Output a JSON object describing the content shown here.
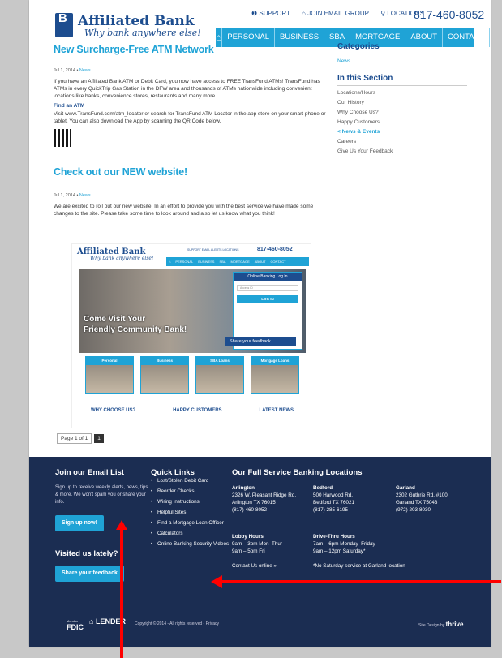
{
  "header": {
    "bank_name": "Affiliated Bank",
    "tagline": "Why bank anywhere else!",
    "logo_letters": "B",
    "utility": [
      "SUPPORT",
      "JOIN EMAIL GROUP",
      "LOCATIONS"
    ],
    "phone": "817-460-8052",
    "nav": [
      "PERSONAL",
      "BUSINESS",
      "SBA",
      "MORTGAGE",
      "ABOUT",
      "CONTACT"
    ]
  },
  "posts": [
    {
      "title": "New Surcharge-Free ATM Network",
      "date": "Jul 1, 2014",
      "category": "News",
      "para1": "If you have an Affiliated Bank ATM or Debit Card, you now have access to FREE TransFund ATMs! TransFund has ATMs in every QuickTrip Gas Station in the DFW area and thousands of ATMs nationwide including convenient locations like banks, convenience stores, restaurants and many more.",
      "subhead": "Find an ATM",
      "para2": "Visit www.TransFund.com/atm_locator or search for TransFund ATM Locator in the app store on your smart phone or tablet.  You can also download the App by scanning the QR Code below."
    },
    {
      "title": "Check out our NEW website!",
      "date": "Jul 1, 2014",
      "category": "News",
      "para1": "We are excited to roll out our new website. In an effort to provide you with the best service we have made some changes to the site. Please take some time to look around and also let us know what you think!"
    }
  ],
  "thumb": {
    "bank_name": "Affiliated Bank",
    "tagline": "Why bank anywhere else!",
    "phone": "817-460-8052",
    "utility": "SUPPORT  EMAIL ALERTS  LOCATIONS",
    "nav": [
      "PERSONAL",
      "BUSINESS",
      "SBA",
      "MORTGAGE",
      "ABOUT",
      "CONTACT"
    ],
    "hero_line1": "Come Visit Your",
    "hero_line2": "Friendly Community Bank!",
    "login_title": "Online Banking Log In",
    "login_placeholder": "Access ID",
    "login_button": "LOG IN",
    "feedback": "Share your feedback",
    "cards": [
      "Personal",
      "Business",
      "SBA Loans",
      "Mortgage Loans"
    ],
    "links": [
      "WHY CHOOSE US?",
      "HAPPY CUSTOMERS",
      "LATEST NEWS"
    ]
  },
  "pager": {
    "label": "Page 1 of 1",
    "current": "1"
  },
  "sidebar": {
    "categories_heading": "Categories",
    "categories": [
      "News"
    ],
    "section_heading": "In this Section",
    "links": [
      "Locations/Hours",
      "Our History",
      "Why Choose Us?",
      "Happy Customers",
      "< News & Events",
      "Careers",
      "Give Us Your Feedback"
    ],
    "active_index": 4
  },
  "footer": {
    "email_heading": "Join our Email List",
    "email_text": "Sign up to receive weekly alerts, news, tips & more. We won't spam you or share your info.",
    "signup_button": "Sign up now!",
    "visited_heading": "Visited us lately?",
    "feedback_button": "Share your feedback",
    "quick_heading": "Quick Links",
    "quick_links": [
      "Lost/Stolen Debit Card",
      "Reorder Checks",
      "Wiring Instructions",
      "Helpful Sites",
      "Find a Mortgage Loan Officer",
      "Calculators",
      "Online Banking Security Videos"
    ],
    "locations_heading": "Our Full Service Banking Locations",
    "locations": [
      {
        "name": "Arlington",
        "l1": "2326 W. Pleasant Ridge Rd.",
        "l2": "Arlington TX 76015",
        "l3": "(817) 460-8052"
      },
      {
        "name": "Bedford",
        "l1": "500 Harwood Rd.",
        "l2": "Bedford TX 76021",
        "l3": "(817) 285-6195"
      },
      {
        "name": "Garland",
        "l1": "2302 Guthrie Rd. #100",
        "l2": "Garland TX 75043",
        "l3": "(972) 203-8030"
      }
    ],
    "lobby_heading": "Lobby Hours",
    "lobby_l1": "9am – 3pm Mon–Thur",
    "lobby_l2": "9am – 5pm Fri",
    "contact_link": "Contact Us online »",
    "drive_heading": "Drive-Thru Hours",
    "drive_l1": "7am – 6pm Monday–Friday",
    "drive_l2": "9am – 12pm Saturday*",
    "drive_note": "*No Saturday service at Garland location",
    "member": "Member",
    "fdic": "FDIC",
    "equal_housing": "LENDER",
    "copyright": "Copyright © 2014 - All rights reserved - Privacy",
    "design_by": "Site Design by",
    "designer": "thrive"
  },
  "colors": {
    "accent": "#1fa3d6",
    "brand": "#1d4d8f",
    "footer": "#1b2d52",
    "annotation": "#ff0000"
  }
}
